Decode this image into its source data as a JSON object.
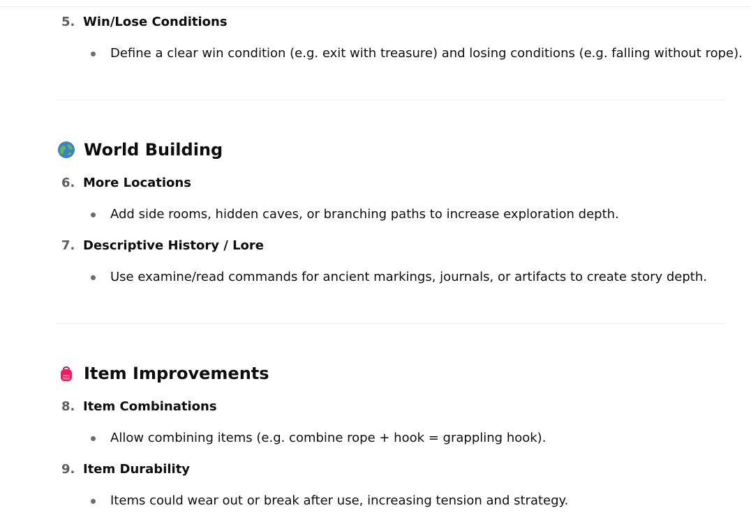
{
  "items": [
    {
      "number": "5.",
      "title": "Win/Lose Conditions",
      "bullet": "Define a clear win condition (e.g. exit with treasure) and losing conditions (e.g. falling without rope)."
    },
    {
      "number": "6.",
      "title": "More Locations",
      "bullet": "Add side rooms, hidden caves, or branching paths to increase exploration depth."
    },
    {
      "number": "7.",
      "title": "Descriptive History / Lore",
      "bullet": "Use examine/read commands for ancient markings, journals, or artifacts to create story depth."
    },
    {
      "number": "8.",
      "title": "Item Combinations",
      "bullet": "Allow combining items (e.g. combine rope + hook = grappling hook)."
    },
    {
      "number": "9.",
      "title": "Item Durability",
      "bullet": "Items could wear out or break after use, increasing tension and strategy."
    }
  ],
  "sections": [
    {
      "title": "World Building",
      "icon": "globe-icon"
    },
    {
      "title": "Item Improvements",
      "icon": "backpack-icon"
    }
  ]
}
